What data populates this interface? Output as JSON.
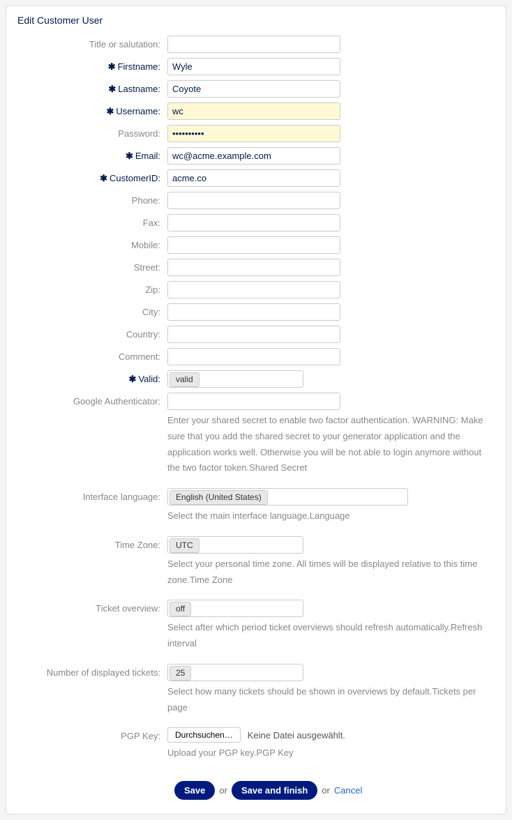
{
  "panel": {
    "title": "Edit Customer User"
  },
  "labels": {
    "title_salutation": "Title or salutation:",
    "firstname": "Firstname:",
    "lastname": "Lastname:",
    "username": "Username:",
    "password": "Password:",
    "email": "Email:",
    "customerid": "CustomerID:",
    "phone": "Phone:",
    "fax": "Fax:",
    "mobile": "Mobile:",
    "street": "Street:",
    "zip": "Zip:",
    "city": "City:",
    "country": "Country:",
    "comment": "Comment:",
    "valid": "Valid:",
    "google_auth": "Google Authenticator:",
    "language": "Interface language:",
    "timezone": "Time Zone:",
    "ticket_overview": "Ticket overview:",
    "num_tickets": "Number of displayed tickets:",
    "pgp_key": "PGP Key:"
  },
  "values": {
    "title_salutation": "",
    "firstname": "Wyle",
    "lastname": "Coyote",
    "username": "wc",
    "password": "••••••••••",
    "email": "wc@acme.example.com",
    "customerid": "acme.co",
    "phone": "",
    "fax": "",
    "mobile": "",
    "street": "",
    "zip": "",
    "city": "",
    "country": "",
    "comment": "",
    "valid": "valid",
    "google_auth": "",
    "language": "English (United States)",
    "timezone": "UTC",
    "ticket_overview": "off",
    "num_tickets": "25"
  },
  "help": {
    "google_auth": "Enter your shared secret to enable two factor authentication. WARNING: Make sure that you add the shared secret to your generator application and the application works well. Otherwise you will be not able to login anymore without the two factor token.Shared Secret",
    "language": "Select the main interface language.Language",
    "timezone": "Select your personal time zone. All times will be displayed relative to this time zone.Time Zone",
    "ticket_overview": "Select after which period ticket overviews should refresh automatically.Refresh interval",
    "num_tickets": "Select how many tickets should be shown in overviews by default.Tickets per page",
    "pgp_key": "Upload your PGP key.PGP Key"
  },
  "file": {
    "browse": "Durchsuchen…",
    "none_selected": "Keine Datei ausgewählt."
  },
  "buttons": {
    "save": "Save",
    "or1": "or",
    "save_finish": "Save and finish",
    "or2": "or",
    "cancel": "Cancel"
  },
  "star": "✱"
}
